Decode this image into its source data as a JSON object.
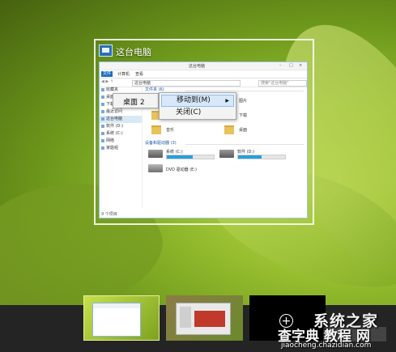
{
  "window": {
    "title": "这台电脑",
    "app_icon": "this-pc-icon"
  },
  "explorer_thumbnail": {
    "title": "这台电脑",
    "ribbon_file": "文件",
    "ribbon_tab": "计算机",
    "ribbon_view": "查看",
    "address": "这台电脑",
    "search_placeholder": "搜索\"这台电脑\"",
    "sidebar": [
      {
        "label": "收藏夹"
      },
      {
        "label": "桌面"
      },
      {
        "label": "下载"
      },
      {
        "label": "最近访问"
      },
      {
        "label": "这台电脑"
      },
      {
        "label": "软件 (D:)"
      },
      {
        "label": "系统 (C:)"
      },
      {
        "label": "网络"
      },
      {
        "label": "家庭组"
      }
    ],
    "folders_section": "文件夹 (6)",
    "folders": [
      {
        "label": "视频"
      },
      {
        "label": "图片"
      },
      {
        "label": "文档"
      },
      {
        "label": "下载"
      },
      {
        "label": "音乐"
      },
      {
        "label": "桌面"
      }
    ],
    "drives_section": "设备和驱动器 (3)",
    "drives": [
      {
        "name": "系统 (C:)",
        "free": "",
        "fill": 0.55
      },
      {
        "name": "软件 (D:)",
        "free": "",
        "fill": 0.5
      },
      {
        "name": "DVD 驱动器 (E:)",
        "free": "",
        "fill": 0
      }
    ],
    "status": "9 个项目"
  },
  "context_menu_desktop": {
    "label": "桌面 2"
  },
  "context_menu": {
    "items": [
      {
        "label": "移动到(M)",
        "has_submenu": true,
        "highlighted": true
      },
      {
        "label": "关闭(C)",
        "has_submenu": false,
        "highlighted": false
      }
    ],
    "submenu_arrow": "▶"
  },
  "task_view": {
    "desktops": [
      {
        "name": "desktop-1"
      },
      {
        "name": "desktop-2"
      },
      {
        "name": "desktop-new"
      }
    ],
    "add_desktop_icon": "+"
  },
  "watermark": {
    "line1": "系统之家",
    "line2": "查字典 教程 网",
    "line3": "jiaocheng.chazidian.com"
  },
  "colors": {
    "accent": "#26a0da",
    "highlight": "#d6e8fa",
    "taskbar": "#242424"
  }
}
